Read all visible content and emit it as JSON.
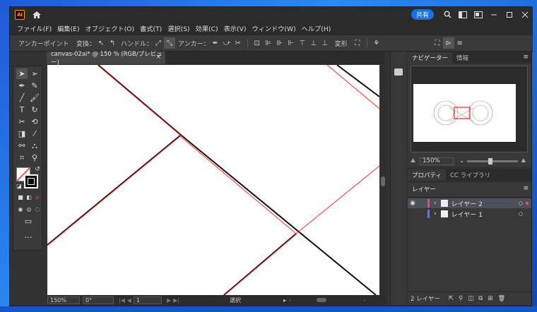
{
  "app": {
    "logo_text": "Ai",
    "share_label": "共有"
  },
  "menu": [
    "ファイル(F)",
    "編集(E)",
    "オブジェクト(O)",
    "書式(T)",
    "選択(S)",
    "効果(C)",
    "表示(V)",
    "ウィンドウ(W)",
    "ヘルプ(H)"
  ],
  "control_bar": {
    "anchor_point_label": "アンカーポイント",
    "convert_label": "変換：",
    "handle_label": "ハンドル：",
    "anchor_label": "アンカー：",
    "transform_label": "変形"
  },
  "document": {
    "tab_title": "canvas-02ai* @ 150 % (RGB/プレビュー)",
    "close_glyph": "×"
  },
  "status": {
    "zoom": "150%",
    "rotation": "0°",
    "artboard": "1",
    "mode": "選択"
  },
  "panels": {
    "navigator_tab": "ナビゲーター",
    "info_tab": "情報",
    "nav_zoom": "150%",
    "properties_tab": "プロパティ",
    "libraries_tab": "CC ライブラリ",
    "layers_tab": "レイヤー",
    "layers": [
      {
        "name": "レイヤー 2",
        "color": "#e85050",
        "selected": true
      },
      {
        "name": "レイヤー 1",
        "color": "#4f7bff",
        "selected": false
      }
    ],
    "layer_count": "2 レイヤー"
  },
  "colors": {
    "accent": "#1473e6",
    "ui_bg": "#323232",
    "path_red": "#ff3030"
  }
}
